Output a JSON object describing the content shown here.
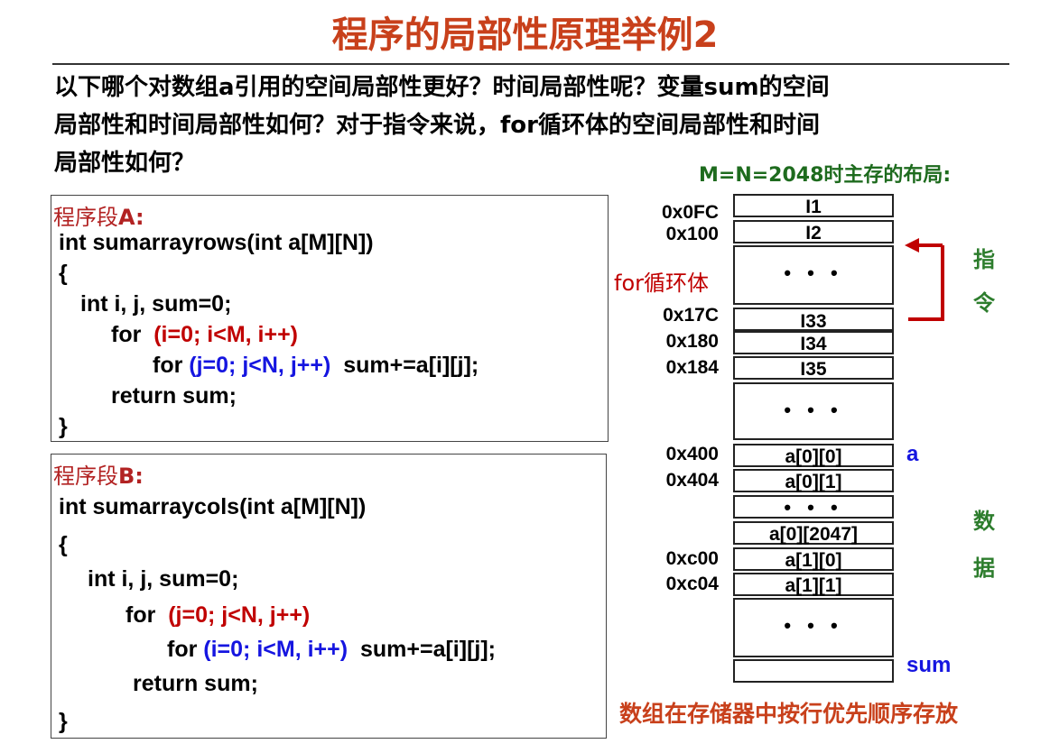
{
  "title": "程序的局部性原理举例2",
  "question": {
    "line1": "以下哪个对数组a引用的空间局部性更好？时间局部性呢？变量sum的空间",
    "line2": "局部性和时间局部性如何？对于指令来说，for循环体的空间局部性和时间",
    "line3": "局部性如何？"
  },
  "segA": {
    "label_prefix": "程序段",
    "label_suffix": "A:",
    "line1": "int sumarrayrows(int a[M][N])",
    "line2": "{",
    "line3": "int i, j, sum=0;",
    "for1_kw": "for",
    "for1_cond": "(i=0; i<M, i++)",
    "for2_kw": "for",
    "for2_cond": "(j=0; j<N, j++)",
    "body": "sum+=a[i][j];",
    "ret": "return sum;",
    "close": "}"
  },
  "segB": {
    "label_prefix": "程序段",
    "label_suffix": "B:",
    "line1": "int sumarraycols(int a[M][N])",
    "line2": "{",
    "line3": "int i, j, sum=0;",
    "for1_kw": "for",
    "for1_cond": "(j=0; j<N, j++)",
    "for2_kw": "for",
    "for2_cond": "(i=0; i<M, i++)",
    "body": "sum+=a[i][j];",
    "ret": "return sum;",
    "close": "}"
  },
  "memory": {
    "caption": "M=N=2048时主存的布局:",
    "addresses": {
      "a0FC": "0x0FC",
      "a100": "0x100",
      "a17C": "0x17C",
      "a180": "0x180",
      "a184": "0x184",
      "a400": "0x400",
      "a404": "0x404",
      "ac00": "0xc00",
      "ac04": "0xc04"
    },
    "cells": {
      "i1": "I1",
      "i2": "I2",
      "dots1": "• • •",
      "i33": "I33",
      "i34": "I34",
      "i35": "I35",
      "dots2": "• • •",
      "a00": "a[0][0]",
      "a01": "a[0][1]",
      "dots3": "• • •",
      "a02047": "a[0][2047]",
      "a10": "a[1][0]",
      "a11": "a[1][1]",
      "dots4": "• • •"
    },
    "for_label": "for循环体",
    "instr_label_1": "指",
    "instr_label_2": "令",
    "data_label_1": "数",
    "data_label_2": "据",
    "a_label": "a",
    "sum_label": "sum",
    "footer": "数组在存储器中按行优先顺序存放"
  },
  "colors": {
    "title": "#c8401b",
    "red": "#c00000",
    "blue": "#1515e0",
    "green": "#2d7d2d",
    "caption": "#1e6b1e"
  }
}
